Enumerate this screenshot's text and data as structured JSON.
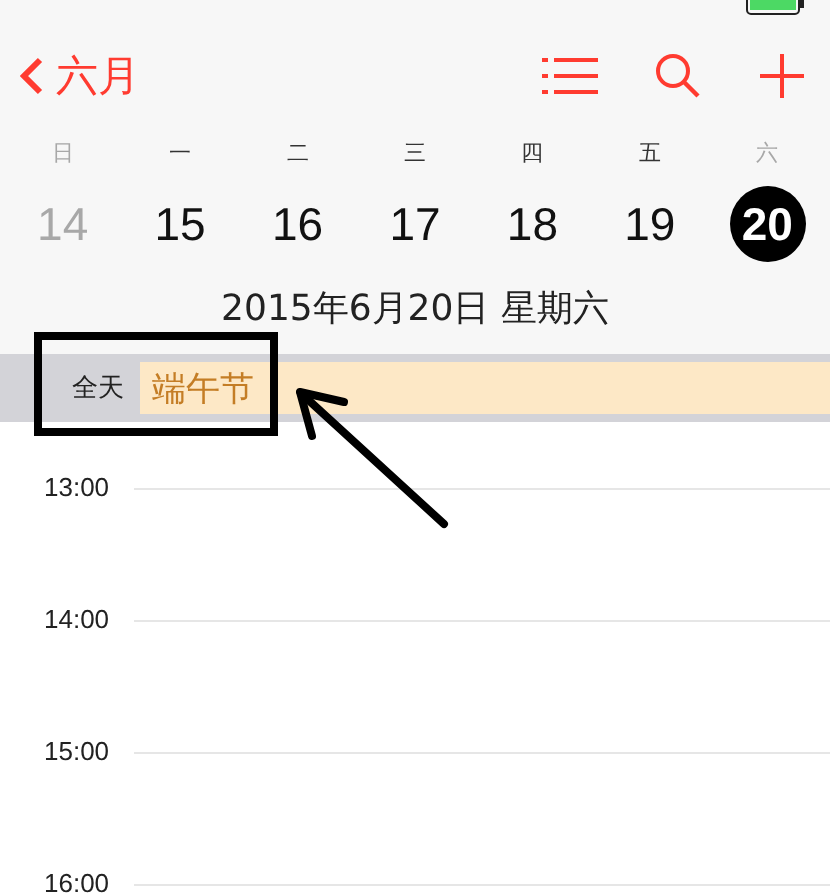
{
  "nav": {
    "back_label": "六月"
  },
  "week": [
    {
      "weekday": "日",
      "date": "14",
      "weekend": true,
      "selected": false
    },
    {
      "weekday": "一",
      "date": "15",
      "weekend": false,
      "selected": false
    },
    {
      "weekday": "二",
      "date": "16",
      "weekend": false,
      "selected": false
    },
    {
      "weekday": "三",
      "date": "17",
      "weekend": false,
      "selected": false
    },
    {
      "weekday": "四",
      "date": "18",
      "weekend": false,
      "selected": false
    },
    {
      "weekday": "五",
      "date": "19",
      "weekend": false,
      "selected": false
    },
    {
      "weekday": "六",
      "date": "20",
      "weekend": true,
      "selected": true
    }
  ],
  "date_title": "2015年6月20日 星期六",
  "all_day": {
    "label": "全天",
    "events": [
      {
        "title": "端午节",
        "color": "#fde8c6"
      }
    ]
  },
  "hours": [
    "13:00",
    "14:00",
    "15:00",
    "16:00"
  ]
}
